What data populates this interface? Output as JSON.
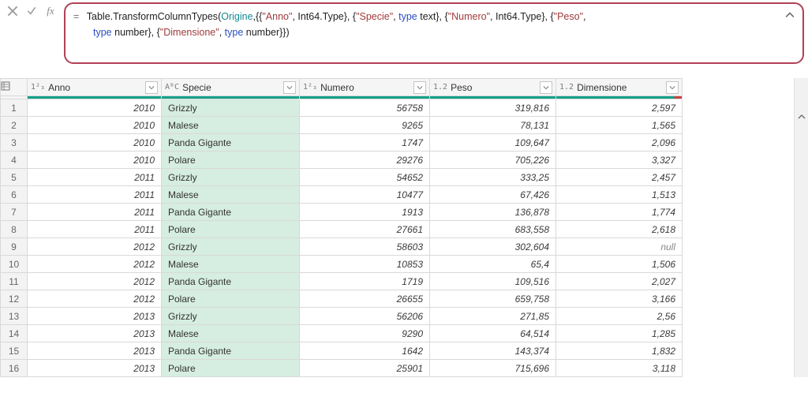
{
  "formula": {
    "tokens": [
      {
        "t": "= ",
        "c": "eq"
      },
      {
        "t": "Table.TransformColumnTypes",
        "c": "tk-black"
      },
      {
        "t": "(",
        "c": "tk-black"
      },
      {
        "t": "Origine",
        "c": "tk-cyan"
      },
      {
        "t": ",{{",
        "c": "tk-black"
      },
      {
        "t": "\"Anno\"",
        "c": "tk-red"
      },
      {
        "t": ", Int64.Type}, {",
        "c": "tk-black"
      },
      {
        "t": "\"Specie\"",
        "c": "tk-red"
      },
      {
        "t": ", ",
        "c": "tk-black"
      },
      {
        "t": "type",
        "c": "tk-blue"
      },
      {
        "t": " text}, {",
        "c": "tk-black"
      },
      {
        "t": "\"Numero\"",
        "c": "tk-red"
      },
      {
        "t": ", Int64.Type}, {",
        "c": "tk-black"
      },
      {
        "t": "\"Peso\"",
        "c": "tk-red"
      },
      {
        "t": ", ",
        "c": "tk-black"
      },
      {
        "t": "\n",
        "c": "br"
      },
      {
        "t": "type",
        "c": "tk-blue"
      },
      {
        "t": " number}, {",
        "c": "tk-black"
      },
      {
        "t": "\"Dimensione\"",
        "c": "tk-red"
      },
      {
        "t": ", ",
        "c": "tk-black"
      },
      {
        "t": "type",
        "c": "tk-blue"
      },
      {
        "t": " number}})",
        "c": "tk-black"
      }
    ]
  },
  "columns": [
    {
      "name": "Anno",
      "type": "1²₃",
      "key": "anno",
      "cls": "c-anno",
      "align": "num",
      "quality": "full"
    },
    {
      "name": "Specie",
      "type": "AᴮC",
      "key": "specie",
      "cls": "c-specie",
      "align": "txt",
      "quality": "full"
    },
    {
      "name": "Numero",
      "type": "1²₃",
      "key": "numero",
      "cls": "c-numero",
      "align": "num",
      "quality": "full"
    },
    {
      "name": "Peso",
      "type": "1.2",
      "key": "peso",
      "cls": "c-peso",
      "align": "num",
      "quality": "full"
    },
    {
      "name": "Dimensione",
      "type": "1.2",
      "key": "dim",
      "cls": "c-dim",
      "align": "num",
      "quality": "split"
    }
  ],
  "rows": [
    {
      "n": "1",
      "anno": "2010",
      "specie": "Grizzly",
      "numero": "56758",
      "peso": "319,816",
      "dim": "2,597"
    },
    {
      "n": "2",
      "anno": "2010",
      "specie": "Malese",
      "numero": "9265",
      "peso": "78,131",
      "dim": "1,565"
    },
    {
      "n": "3",
      "anno": "2010",
      "specie": "Panda Gigante",
      "numero": "1747",
      "peso": "109,647",
      "dim": "2,096"
    },
    {
      "n": "4",
      "anno": "2010",
      "specie": "Polare",
      "numero": "29276",
      "peso": "705,226",
      "dim": "3,327"
    },
    {
      "n": "5",
      "anno": "2011",
      "specie": "Grizzly",
      "numero": "54652",
      "peso": "333,25",
      "dim": "2,457"
    },
    {
      "n": "6",
      "anno": "2011",
      "specie": "Malese",
      "numero": "10477",
      "peso": "67,426",
      "dim": "1,513"
    },
    {
      "n": "7",
      "anno": "2011",
      "specie": "Panda Gigante",
      "numero": "1913",
      "peso": "136,878",
      "dim": "1,774"
    },
    {
      "n": "8",
      "anno": "2011",
      "specie": "Polare",
      "numero": "27661",
      "peso": "683,558",
      "dim": "2,618"
    },
    {
      "n": "9",
      "anno": "2012",
      "specie": "Grizzly",
      "numero": "58603",
      "peso": "302,604",
      "dim": "null"
    },
    {
      "n": "10",
      "anno": "2012",
      "specie": "Malese",
      "numero": "10853",
      "peso": "65,4",
      "dim": "1,506"
    },
    {
      "n": "11",
      "anno": "2012",
      "specie": "Panda Gigante",
      "numero": "1719",
      "peso": "109,516",
      "dim": "2,027"
    },
    {
      "n": "12",
      "anno": "2012",
      "specie": "Polare",
      "numero": "26655",
      "peso": "659,758",
      "dim": "3,166"
    },
    {
      "n": "13",
      "anno": "2013",
      "specie": "Grizzly",
      "numero": "56206",
      "peso": "271,85",
      "dim": "2,56"
    },
    {
      "n": "14",
      "anno": "2013",
      "specie": "Malese",
      "numero": "9290",
      "peso": "64,514",
      "dim": "1,285"
    },
    {
      "n": "15",
      "anno": "2013",
      "specie": "Panda Gigante",
      "numero": "1642",
      "peso": "143,374",
      "dim": "1,832"
    },
    {
      "n": "16",
      "anno": "2013",
      "specie": "Polare",
      "numero": "25901",
      "peso": "715,696",
      "dim": "3,118"
    }
  ]
}
